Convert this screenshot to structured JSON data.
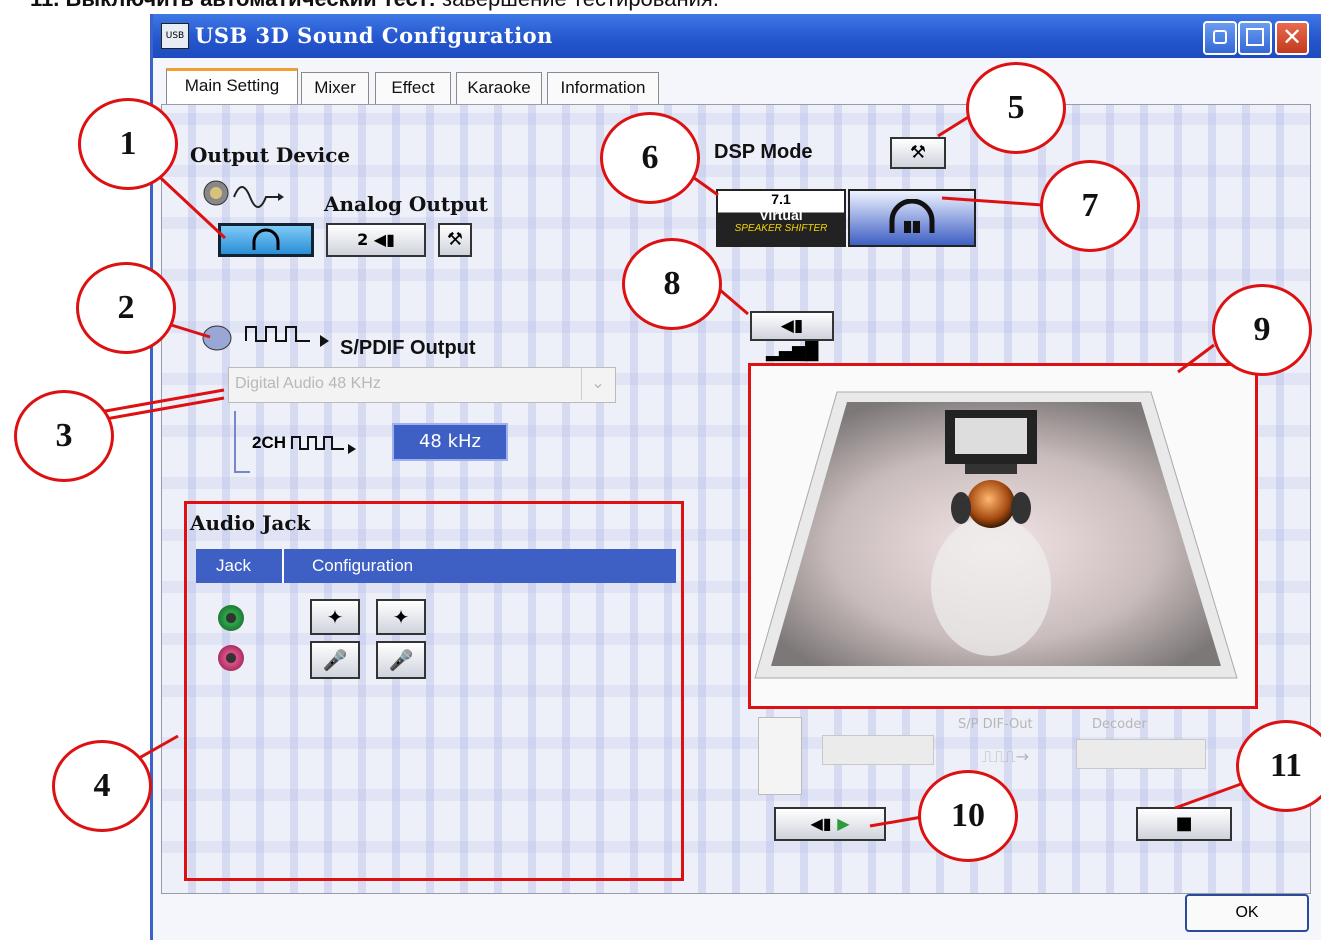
{
  "caption": {
    "bold": "11. Выключить автоматический тест:",
    "rest": " завершение тестирования."
  },
  "window": {
    "title": "USB 3D Sound Configuration",
    "icon_label": "USB",
    "close_glyph": "✕"
  },
  "tabs": [
    "Main Setting",
    "Mixer",
    "Effect",
    "Karaoke",
    "Information"
  ],
  "output_device": {
    "heading": "Output Device",
    "analog_label": "Analog Output",
    "speaker_count": "2",
    "spdif_label": "S/PDIF Output",
    "digital_select_value": "Digital Audio 48 KHz",
    "channel_label": "2CH",
    "sample_rate": "48 kHz"
  },
  "dsp": {
    "heading": "DSP Mode",
    "virtual_top": "7.1",
    "virtual_mid": "Virtual",
    "virtual_bottom": "SPEAKER SHIFTER"
  },
  "audio_jack": {
    "heading": "Audio Jack",
    "columns": [
      "Jack",
      "Configuration"
    ]
  },
  "diagram": {
    "spdif_out": "S/P DIF-Out",
    "decoder": "Decoder"
  },
  "buttons": {
    "ok": "OK"
  },
  "callouts": [
    "1",
    "2",
    "3",
    "4",
    "5",
    "6",
    "7",
    "8",
    "9",
    "10",
    "11"
  ],
  "icons": [
    "headphone-icon",
    "speaker-icon",
    "wrench-icon",
    "volume-icon",
    "play-icon",
    "stop-icon",
    "green-jack-icon",
    "pink-jack-icon",
    "microphone-icon"
  ]
}
